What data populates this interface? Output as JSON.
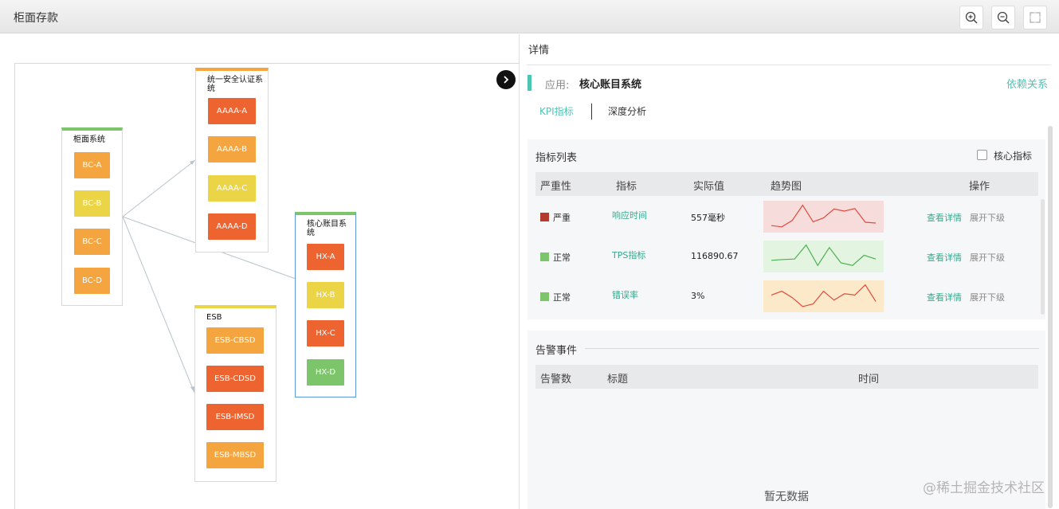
{
  "window": {
    "title": "柜面存款"
  },
  "toolbar": {
    "zoom_in": "zoom-in-icon",
    "zoom_out": "zoom-out-icon",
    "fit": "fit-screen-icon"
  },
  "topology": {
    "nodes": [
      {
        "label": "柜面系统",
        "accent": "#7cc56a",
        "items": [
          {
            "label": "BC-A",
            "color": "#f5a53f"
          },
          {
            "label": "BC-B",
            "color": "#ecd447"
          },
          {
            "label": "BC-C",
            "color": "#f5a53f"
          },
          {
            "label": "BC-D",
            "color": "#f5a53f"
          }
        ]
      },
      {
        "label": "统一安全认证系统",
        "accent": "#f5a53f",
        "items": [
          {
            "label": "AAAA-A",
            "color": "#ee6431"
          },
          {
            "label": "AAAA-B",
            "color": "#f5a53f"
          },
          {
            "label": "AAAA-C",
            "color": "#ecd447"
          },
          {
            "label": "AAAA-D",
            "color": "#ee6431"
          }
        ]
      },
      {
        "label": "ESB",
        "accent": "#ecd447",
        "items": [
          {
            "label": "ESB-CBSD",
            "color": "#f5a53f"
          },
          {
            "label": "ESB-CDSD",
            "color": "#ee6431"
          },
          {
            "label": "ESB-IMSD",
            "color": "#ee6431"
          },
          {
            "label": "ESB-MBSD",
            "color": "#f5a53f"
          }
        ]
      },
      {
        "label": "核心账目系统",
        "accent": "#7cc56a",
        "items": [
          {
            "label": "HX-A",
            "color": "#ee6431"
          },
          {
            "label": "HX-B",
            "color": "#ecd447"
          },
          {
            "label": "HX-C",
            "color": "#ee6431"
          },
          {
            "label": "HX-D",
            "color": "#7cc56a"
          }
        ]
      }
    ]
  },
  "detail": {
    "title": "详情",
    "app_label": "应用:",
    "app_name": "核心账目系统",
    "dependency_link": "依赖关系",
    "tabs": [
      {
        "label": "KPI指标",
        "active": true
      },
      {
        "label": "深度分析",
        "active": false
      }
    ],
    "kpi": {
      "title": "指标列表",
      "core_checkbox_label": "核心指标",
      "columns": [
        "严重性",
        "指标",
        "实际值",
        "趋势图",
        "操作"
      ],
      "rows": [
        {
          "severity": "严重",
          "severity_color": "#b33a2c",
          "metric": "响应时间",
          "value": "557毫秒",
          "trend_color": "#e14b3b",
          "trend_bg": "#f7dcdc",
          "trend": [
            0.15,
            0.1,
            0.35,
            0.95,
            0.3,
            0.45,
            0.8,
            0.72,
            0.82,
            0.28,
            0.25
          ],
          "action_detail": "查看详情",
          "action_expand": "展开下级"
        },
        {
          "severity": "正常",
          "severity_color": "#7cc56a",
          "metric": "TPS指标",
          "value": "116890.67",
          "trend_color": "#4cb050",
          "trend_bg": "#e3f4e1",
          "trend": [
            0.35,
            0.38,
            0.4,
            0.95,
            0.15,
            0.85,
            0.25,
            0.15,
            0.55,
            0.4
          ],
          "action_detail": "查看详情",
          "action_expand": "展开下级"
        },
        {
          "severity": "正常",
          "severity_color": "#7cc56a",
          "metric": "错误率",
          "value": "3%",
          "trend_color": "#e14b3b",
          "trend_bg": "#fbe9c9",
          "trend": [
            0.55,
            0.7,
            0.45,
            0.1,
            0.2,
            0.7,
            0.35,
            0.6,
            0.55,
            0.95,
            0.3
          ],
          "action_detail": "查看详情",
          "action_expand": "展开下级"
        }
      ]
    },
    "alerts": {
      "title": "告警事件",
      "columns": [
        "告警数",
        "标题",
        "时间"
      ],
      "empty_text": "暂无数据"
    }
  },
  "watermark": "@稀土掘金技术社区"
}
